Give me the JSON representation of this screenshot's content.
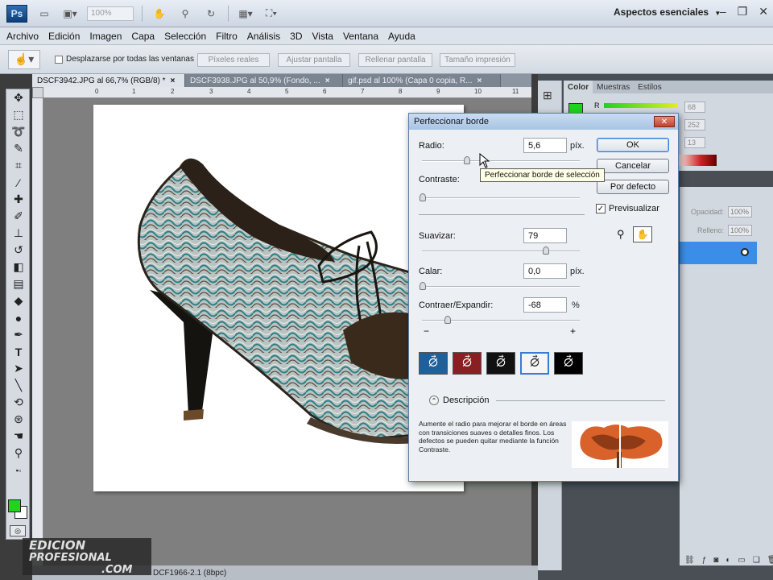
{
  "titlebar": {
    "logo": "Ps",
    "zoom": "100%",
    "workspace": "Aspectos esenciales",
    "workspace_arrow": "▼"
  },
  "menu": [
    "Archivo",
    "Edición",
    "Imagen",
    "Capa",
    "Selección",
    "Filtro",
    "Análisis",
    "3D",
    "Vista",
    "Ventana",
    "Ayuda"
  ],
  "options": {
    "scroll_all": "Desplazarse por todas las ventanas",
    "buttons": [
      "Píxeles reales",
      "Ajustar pantalla",
      "Rellenar pantalla",
      "Tamaño impresión"
    ]
  },
  "doc_tabs": [
    {
      "label": "DSCF3942.JPG al 66,7% (RGB/8) *",
      "close": "×"
    },
    {
      "label": "DSCF3938.JPG al 50,9% (Fondo, ...",
      "close": "×"
    },
    {
      "label": "gif.psd al 100% (Capa 0 copia, R...",
      "close": "×"
    }
  ],
  "ruler": [
    "0",
    "1",
    "2",
    "3",
    "4",
    "5",
    "6",
    "7",
    "8",
    "9",
    "10",
    "11"
  ],
  "status": "DCF1966-2.1 (8bpc)",
  "color_panel": {
    "tabs": [
      "Color",
      "Muestras",
      "Estilos"
    ],
    "channel_r_label": "R",
    "values": [
      "68",
      "252",
      "13"
    ],
    "fg_color": "#1fd31f"
  },
  "layers_panel": {
    "opacity_label": "Opacidad:",
    "opacity_value": "100%",
    "fill_label": "Relleno:",
    "fill_value": "100%"
  },
  "dialog": {
    "title": "Perfeccionar borde",
    "radius_label": "Radio:",
    "radius_value": "5,6",
    "radius_unit": "píx.",
    "contrast_label": "Contraste:",
    "smooth_label": "Suavizar:",
    "smooth_value": "79",
    "feather_label": "Calar:",
    "feather_value": "0,0",
    "feather_unit": "píx.",
    "contract_label": "Contraer/Expandir:",
    "contract_value": "-68",
    "contract_unit": "%",
    "minus": "−",
    "plus": "+",
    "ok": "OK",
    "cancel": "Cancelar",
    "default": "Por defecto",
    "preview": "Previsualizar",
    "preview_checked": "✓",
    "description_title": "Descripción",
    "description": "Aumente el radio para mejorar el borde en áreas con transiciones suaves o detalles finos. Los defectos se pueden quitar mediante la función Contraste."
  },
  "tooltip": "Perfeccionar borde de selección",
  "watermark": {
    "line1": "EDICION",
    "line2": "PROFESIONAL",
    "line3": ".COM"
  }
}
